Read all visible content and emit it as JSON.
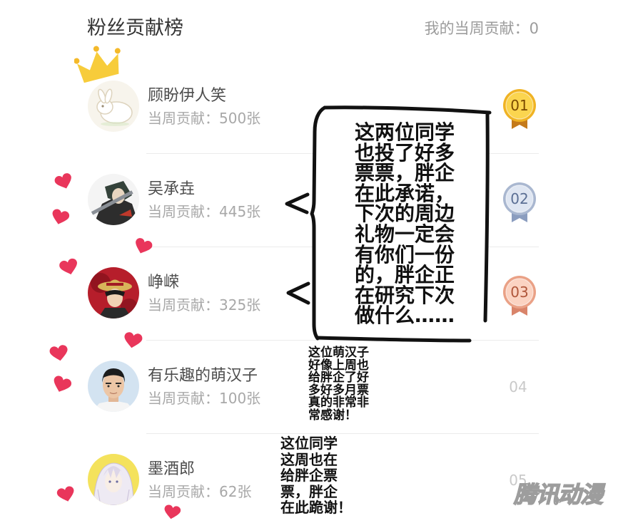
{
  "header": {
    "title": "粉丝贡献榜",
    "my_contribution": "我的当周贡献：0"
  },
  "leaderboard": {
    "rows": [
      {
        "name": "顾盼伊人笑",
        "contribution": "当周贡献：500张",
        "rank": "01",
        "badge": "gold-medal-icon"
      },
      {
        "name": "吴承垚",
        "contribution": "当周贡献：445张",
        "rank": "02",
        "badge": "silver-medal-icon"
      },
      {
        "name": "峥嵘",
        "contribution": "当周贡献：325张",
        "rank": "03",
        "badge": "bronze-medal-icon"
      },
      {
        "name": "有乐趣的萌汉子",
        "contribution": "当周贡献：100张",
        "rank": "04"
      },
      {
        "name": "墨酒郎",
        "contribution": "当周贡献：62张",
        "rank": "05"
      }
    ]
  },
  "annotations": {
    "main_note": [
      "这两位同学",
      "也投了好多",
      "票票，胖企",
      "在此承诺，",
      "下次的周边",
      "礼物一定会",
      "有你们一份",
      "的，胖企正",
      "在研究下次",
      "做什么……"
    ],
    "note_row4": [
      "这位萌汉子",
      "好像上周也",
      "给胖企了好",
      "多好多月票",
      "真的非常非",
      "常感谢！"
    ],
    "note_row5": [
      "这位同学",
      "这周也在",
      "给胖企票",
      "票，胖企",
      "在此跪谢！"
    ]
  },
  "watermark": "腾讯动漫",
  "icons": {
    "top_fan": "crown-icon",
    "decoration": "heart-icon",
    "pointer": "arrow-left-icon"
  },
  "colors": {
    "heart": "#e9365b",
    "crown": "#f7cc3b",
    "crown_dot": "#f4b92a",
    "annotation_ink": "#111111",
    "annotation_paper": "#ffffff",
    "gold": {
      "ring": "#f0b323",
      "fill": "#fbd54f",
      "text": "#7a4a00",
      "ribbon": "#c47a1b"
    },
    "silver": {
      "ring": "#a9b7d0",
      "fill": "#dfe6f2",
      "text": "#5b6f94",
      "ribbon": "#8b9dbf"
    },
    "bronze": {
      "ring": "#eaa186",
      "fill": "#fbd3c2",
      "text": "#b0563a",
      "ribbon": "#d9846a"
    }
  }
}
